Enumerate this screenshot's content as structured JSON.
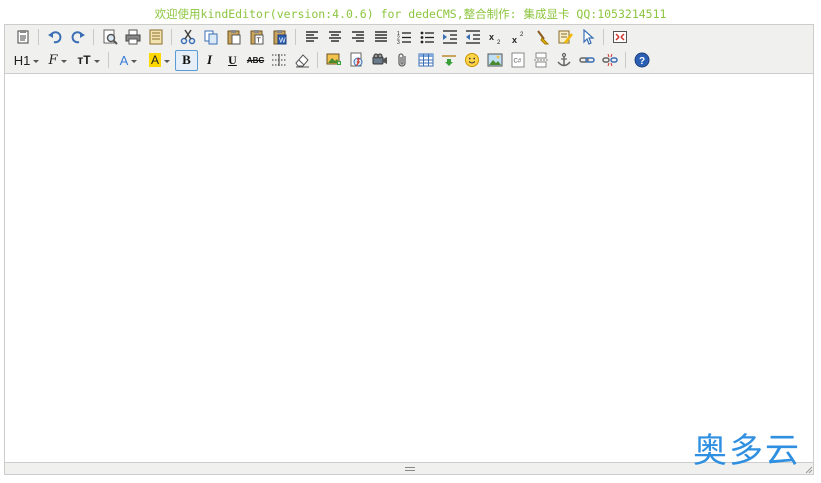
{
  "header": {
    "banner_text": "欢迎使用kindEditor(version:4.0.6) for dedeCMS,整合制作: 集成显卡 QQ:1053214511"
  },
  "toolbar": {
    "row1": [
      {
        "icon": "source-code-icon",
        "title": "HTML代码"
      },
      {
        "icon": "undo-icon",
        "title": "后退"
      },
      {
        "icon": "redo-icon",
        "title": "前进"
      },
      {
        "icon": "preview-icon",
        "title": "预览"
      },
      {
        "icon": "print-icon",
        "title": "打印"
      },
      {
        "icon": "template-icon",
        "title": "插入模板"
      },
      {
        "icon": "cut-icon",
        "title": "剪切"
      },
      {
        "icon": "copy-icon",
        "title": "复制"
      },
      {
        "icon": "paste-icon",
        "title": "粘贴"
      },
      {
        "icon": "paste-plain-icon",
        "title": "粘贴为无格式文本"
      },
      {
        "icon": "paste-word-icon",
        "title": "从Word粘贴"
      },
      {
        "icon": "align-left-icon",
        "title": "左对齐"
      },
      {
        "icon": "align-center-icon",
        "title": "居中"
      },
      {
        "icon": "align-right-icon",
        "title": "右对齐"
      },
      {
        "icon": "align-justify-icon",
        "title": "两端对齐"
      },
      {
        "icon": "ordered-list-icon",
        "title": "编号"
      },
      {
        "icon": "unordered-list-icon",
        "title": "项目符号"
      },
      {
        "icon": "indent-icon",
        "title": "增加缩进"
      },
      {
        "icon": "outdent-icon",
        "title": "减少缩进"
      },
      {
        "icon": "subscript-icon",
        "title": "下标"
      },
      {
        "icon": "superscript-icon",
        "title": "上标"
      },
      {
        "icon": "clear-html-icon",
        "title": "清理HTML代码"
      },
      {
        "icon": "quick-format-icon",
        "title": "一键排版"
      },
      {
        "icon": "select-all-icon",
        "title": "全选"
      },
      {
        "icon": "fullscreen-icon",
        "title": "全屏显示"
      }
    ],
    "row2": {
      "heading_label": "H1",
      "font_family_label": "F",
      "font_size_label": "тT",
      "fore_color_label": "A",
      "hilite_color_label": "A",
      "bold_label": "B",
      "italic_label": "I",
      "underline_label": "U",
      "strike_label": "ABC",
      "colors": {
        "fore": "#3a7bd5",
        "hilite": "#ffd800",
        "active_border": "#5b9bd5"
      }
    }
  },
  "watermark": {
    "text": "奥多云",
    "color": "#2f8fe0"
  },
  "theme": {
    "banner_color": "#8cc63e",
    "toolbar_bg": "#f0f0ee",
    "border": "#cccccc"
  }
}
